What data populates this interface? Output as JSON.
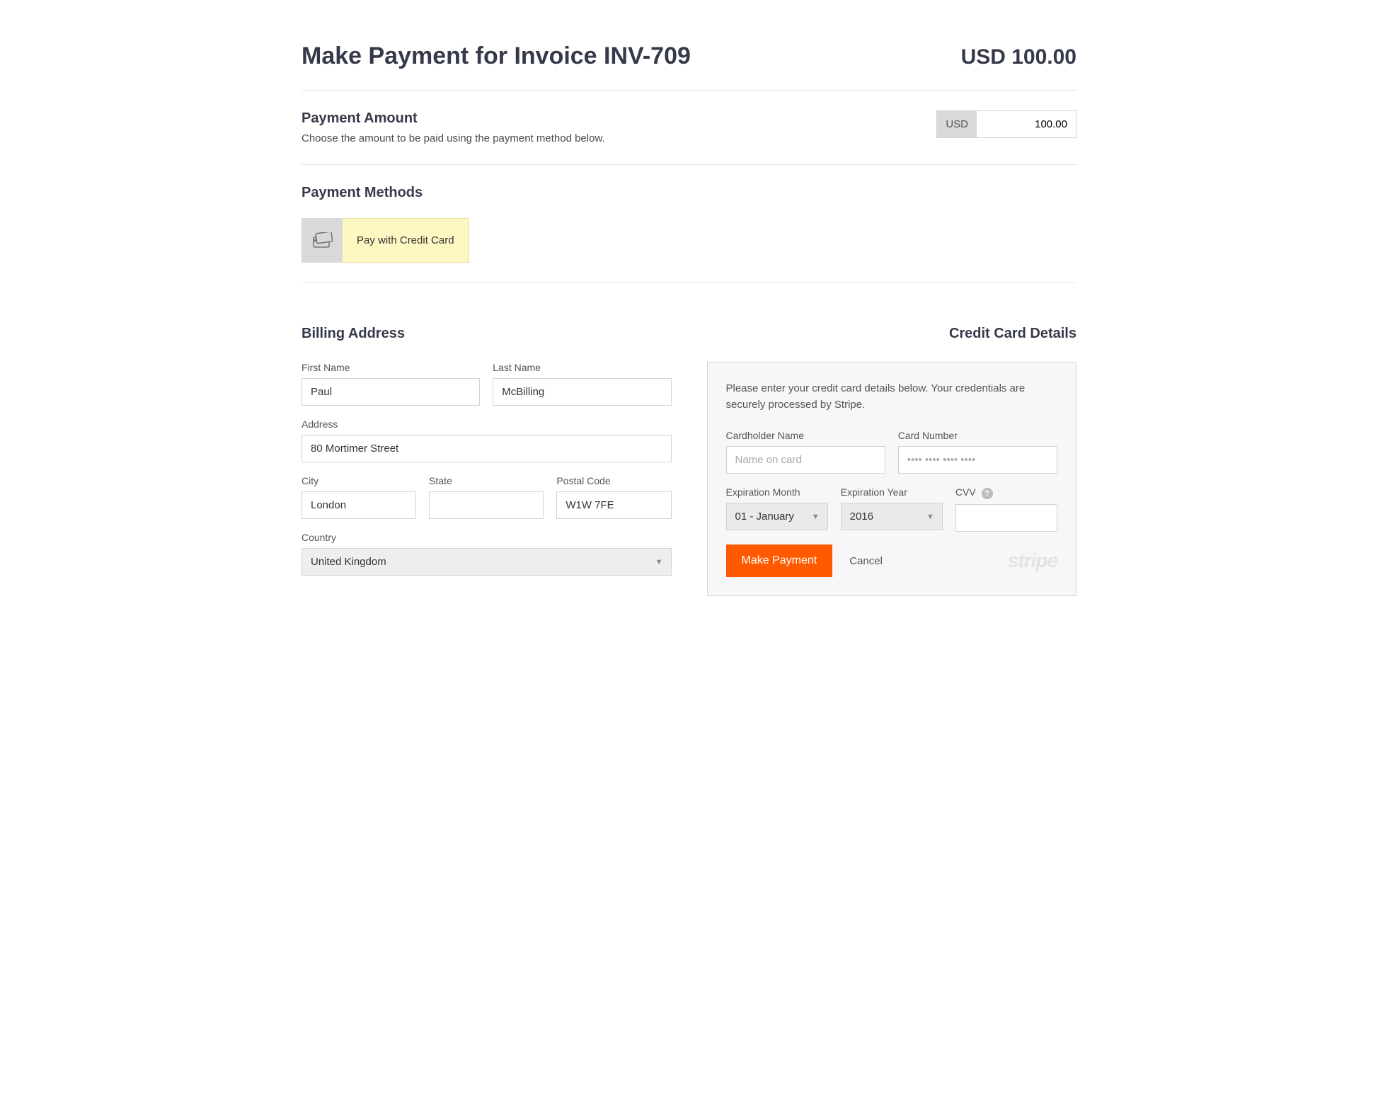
{
  "header": {
    "title": "Make Payment for Invoice INV-709",
    "amount": "USD 100.00"
  },
  "payment_amount": {
    "title": "Payment Amount",
    "desc": "Choose the amount to be paid using the payment method below.",
    "currency": "USD",
    "value": "100.00"
  },
  "payment_methods": {
    "title": "Payment Methods",
    "credit_card_label": "Pay with Credit Card"
  },
  "billing": {
    "title": "Billing Address",
    "first_name_label": "First Name",
    "first_name": "Paul",
    "last_name_label": "Last Name",
    "last_name": "McBilling",
    "address_label": "Address",
    "address": "80 Mortimer Street",
    "city_label": "City",
    "city": "London",
    "state_label": "State",
    "state": "",
    "postal_label": "Postal Code",
    "postal": "W1W 7FE",
    "country_label": "Country",
    "country": "United Kingdom"
  },
  "cc": {
    "title": "Credit Card Details",
    "intro": "Please enter your credit card details below. Your credentials are securely processed by Stripe.",
    "cardholder_label": "Cardholder Name",
    "cardholder_placeholder": "Name on card",
    "cardnumber_label": "Card Number",
    "cardnumber_placeholder": "•••• •••• •••• ••••",
    "exp_month_label": "Expiration Month",
    "exp_month_value": "01 - January",
    "exp_year_label": "Expiration Year",
    "exp_year_value": "2016",
    "cvv_label": "CVV",
    "make_payment": "Make Payment",
    "cancel": "Cancel",
    "processor": "stripe"
  }
}
